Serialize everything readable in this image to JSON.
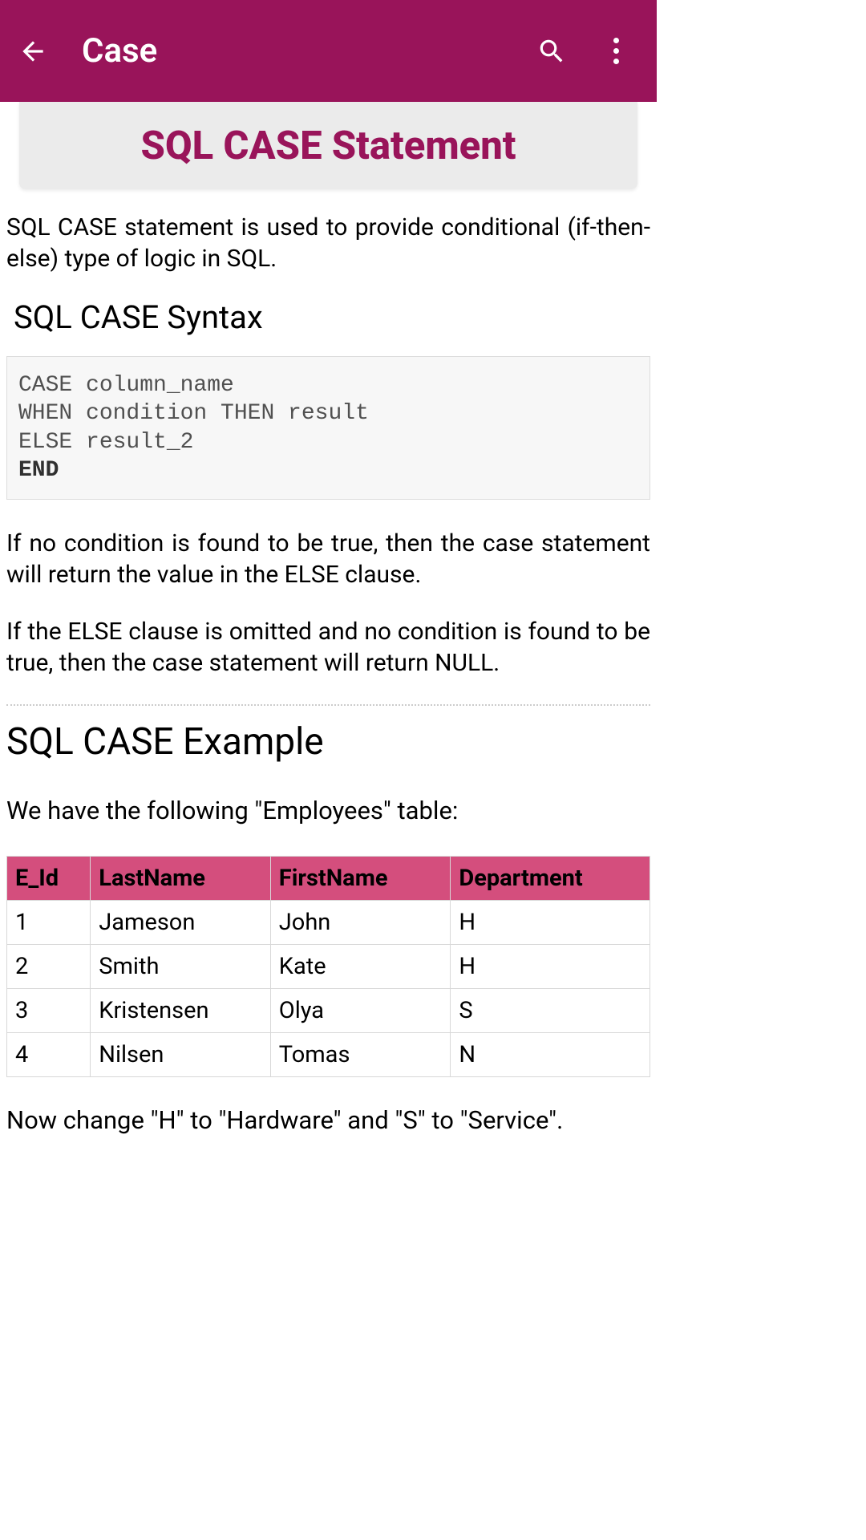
{
  "header": {
    "title": "Case"
  },
  "titleCard": {
    "heading": "SQL CASE Statement"
  },
  "intro": "SQL CASE statement is used to provide conditional (if-then-else) type of logic in SQL.",
  "syntax": {
    "heading": "SQL CASE Syntax",
    "line1": "CASE column_name",
    "line2": "WHEN condition THEN result",
    "line3": "ELSE result_2",
    "line4": "END"
  },
  "paragraph1": "If no condition is found to be true, then the case statement will return the value in the ELSE clause.",
  "paragraph2": "If the ELSE clause is omitted and no condition is found to be true, then the case statement will return NULL.",
  "example": {
    "heading": "SQL CASE Example",
    "intro": "We have the following \"Employees\" table:"
  },
  "table": {
    "headers": {
      "eid": "E_Id",
      "lastname": "LastName",
      "firstname": "FirstName",
      "department": "Department"
    },
    "rows": [
      {
        "eid": "1",
        "lastname": "Jameson",
        "firstname": "John",
        "department": "H"
      },
      {
        "eid": "2",
        "lastname": "Smith",
        "firstname": "Kate",
        "department": "H"
      },
      {
        "eid": "3",
        "lastname": "Kristensen",
        "firstname": "Olya",
        "department": "S"
      },
      {
        "eid": "4",
        "lastname": "Nilsen",
        "firstname": "Tomas",
        "department": "N"
      }
    ]
  },
  "footer": "Now change \"H\" to \"Hardware\" and \"S\" to \"Service\"."
}
